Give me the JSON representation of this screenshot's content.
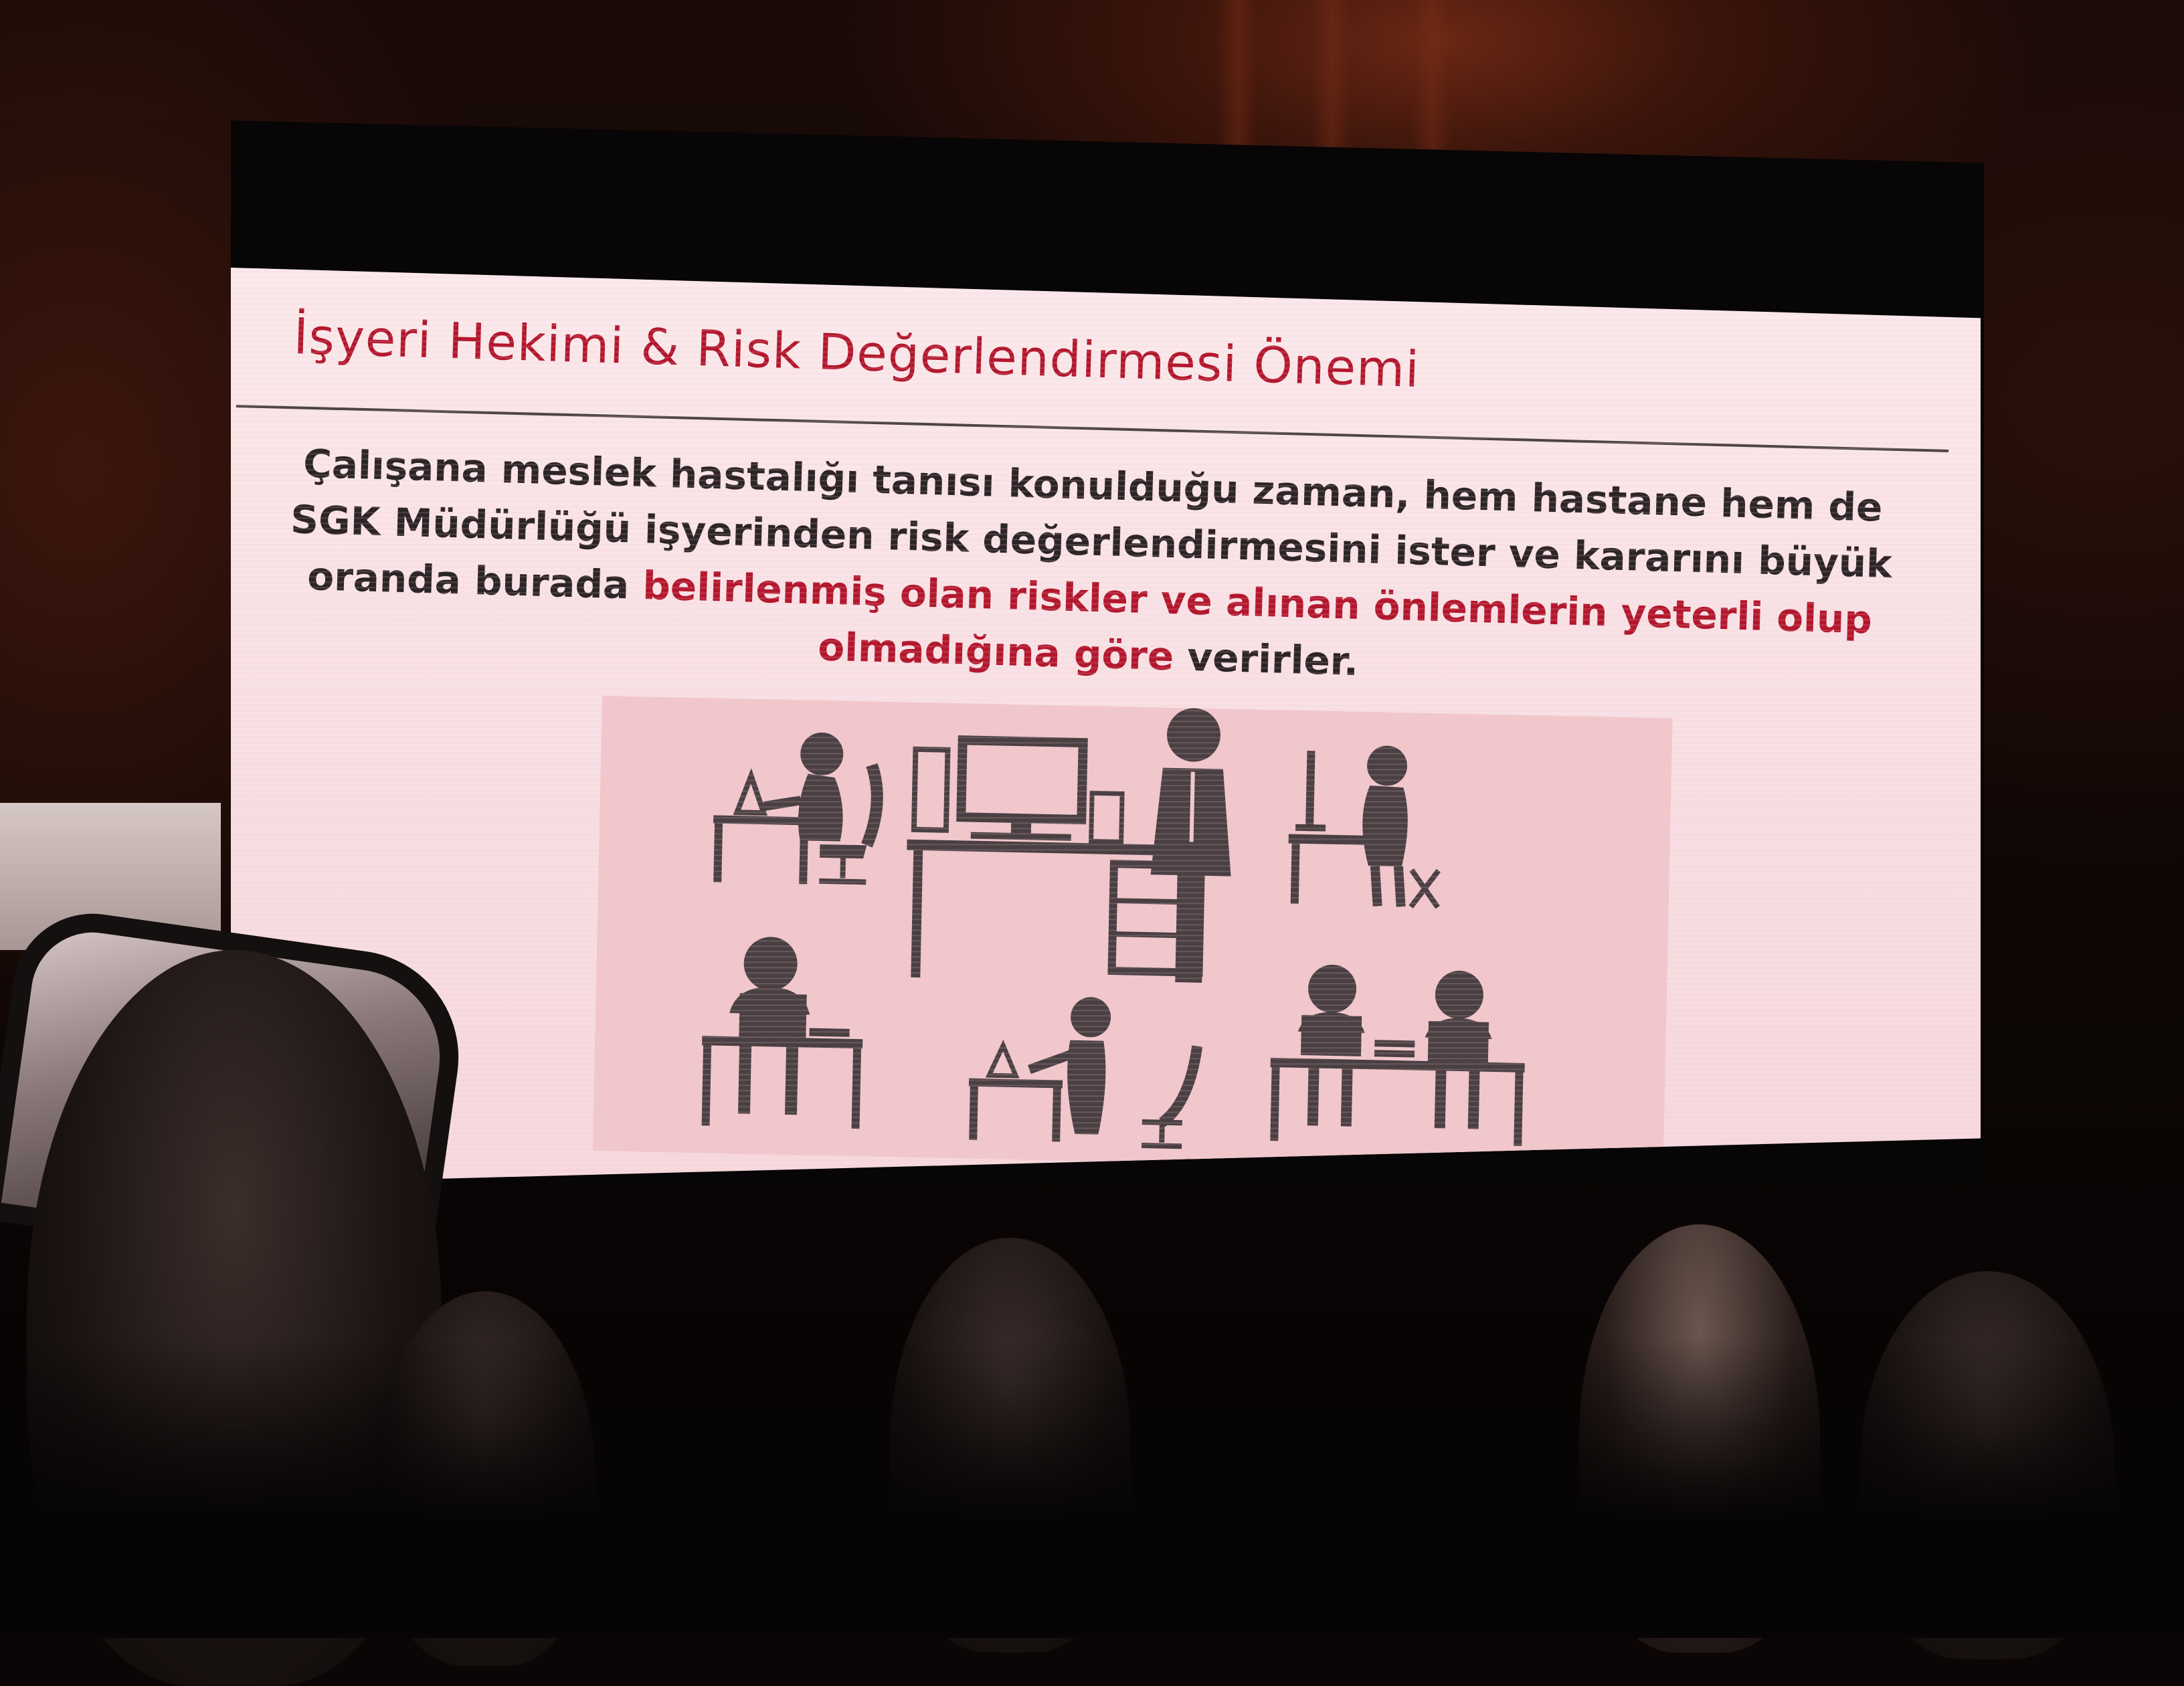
{
  "slide": {
    "title": "İşyeri Hekimi & Risk Değerlendirmesi Önemi",
    "body_parts": [
      "Çalışana meslek hastalığı tanısı konulduğu zaman, hem hastane hem de SGK Müdürlüğü işyerinden risk değerlendirmesini ister ve kararını büyük oranda burada ",
      "belirlenmiş olan riskler ve alınan önlemlerin yeterli olup olmadığına göre",
      " verirler."
    ],
    "illustration": "office-workers-icon-set"
  },
  "colors": {
    "title": "#b3172d",
    "body": "#2c2426",
    "highlight": "#b3172d",
    "slide_background": "#fbe9ec",
    "icon_fill": "#4a3f42"
  }
}
